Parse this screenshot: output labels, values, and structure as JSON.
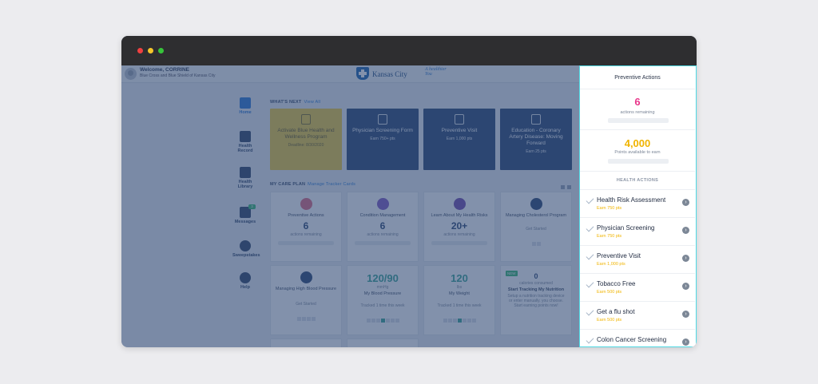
{
  "header": {
    "welcome": "Welcome, CORRINE",
    "subtitle": "Blue Cross and Blue Shield of Kansas City",
    "logo_text": "Kansas City",
    "logo_tagline_1": "A healthier",
    "logo_tagline_2": "You"
  },
  "nav": [
    {
      "label": "Home",
      "icon": "home-icon"
    },
    {
      "label": "Health Record",
      "icon": "clipboard-icon"
    },
    {
      "label": "Health Library",
      "icon": "book-icon"
    },
    {
      "label": "Messages",
      "icon": "message-icon",
      "badge": "3"
    },
    {
      "label": "Sweepstakes",
      "icon": "star-icon"
    },
    {
      "label": "Help",
      "icon": "info-icon"
    }
  ],
  "whats_next": {
    "title": "WHAT'S NEXT",
    "link": "View All",
    "cards": [
      {
        "title": "Activate Blue Health and Wellness Program",
        "sub": "Deadline: 8/30/2020"
      },
      {
        "title": "Physician Screening Form",
        "sub": "Earn 750+ pts"
      },
      {
        "title": "Preventive Visit",
        "sub": "Earn 1,000 pts"
      },
      {
        "title": "Education - Coronary Artery Disease: Moving Forward",
        "sub": "Earn 25 pts"
      }
    ]
  },
  "care_plan": {
    "title": "MY CARE PLAN",
    "link": "Manage Tracker Cards",
    "row1": [
      {
        "title": "Preventive Actions",
        "big": "6",
        "sub": "actions remaining"
      },
      {
        "title": "Condition Management",
        "big": "6",
        "sub": "actions remaining"
      },
      {
        "title": "Learn About My Health Risks",
        "big": "20+",
        "sub": "actions remaining"
      },
      {
        "title": "Managing Cholesterol Program",
        "big": "",
        "sub": "Get Started"
      }
    ],
    "row2": [
      {
        "title": "Managing High Blood Pressure",
        "big": "",
        "sub": "Get Started"
      },
      {
        "title": "My Blood Pressure",
        "big": "120/90",
        "unit": "mmHg",
        "sub": "Tracked 1 time this week"
      },
      {
        "title": "My Weight",
        "big": "120",
        "unit": "lbs",
        "sub": "Tracked 1 time this week"
      },
      {
        "title": "Start Tracking My Nutrition",
        "big": "0",
        "unit": "calories consumed",
        "sub": "Setup a nutrition tracking device or enter manually. you choose. Start earning points now!",
        "badge": "NEW"
      }
    ]
  },
  "panel": {
    "title": "Preventive Actions",
    "actions_count": "6",
    "actions_label": "actions remaining",
    "points": "4,000",
    "points_label": "Points available to earn",
    "section": "HEALTH ACTIONS",
    "items": [
      {
        "title": "Health Risk Assessment",
        "earn": "Earn 750 pts"
      },
      {
        "title": "Physician Screening",
        "earn": "Earn 750 pts"
      },
      {
        "title": "Preventive Visit",
        "earn": "Earn 1,000 pts"
      },
      {
        "title": "Tobacco Free",
        "earn": "Earn 500 pts"
      },
      {
        "title": "Get a flu shot",
        "earn": "Earn 500 pts"
      },
      {
        "title": "Colon Cancer Screening",
        "earn": ""
      }
    ]
  },
  "colors": {
    "highlight": "#4fd9e4",
    "navy": "#1f3b69",
    "gold": "#f0b400",
    "pink": "#e9368a"
  }
}
